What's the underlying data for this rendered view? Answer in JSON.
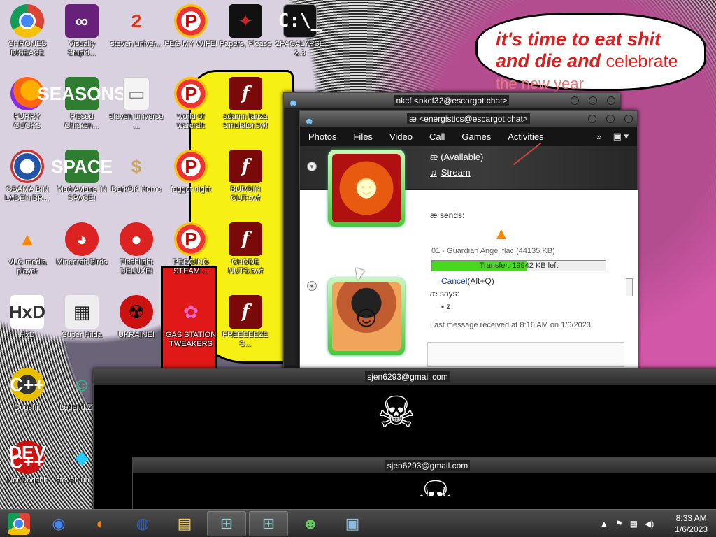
{
  "wallpaper": {
    "speech_line1": "it's time to eat shit",
    "speech_line2a": "and die and",
    "speech_line2b": "celebrate",
    "speech_line3": "the new year"
  },
  "desktop_icons": [
    {
      "label": "CHRONES DISEASE",
      "icon": "chrome-icon",
      "glyph": ""
    },
    {
      "label": "Visually Stupid...",
      "icon": "visual-studio-icon",
      "glyph": "∞"
    },
    {
      "label": "steven univer...",
      "icon": "number-two-icon",
      "glyph": "2"
    },
    {
      "label": "PEG MY WIFE!",
      "icon": "peggle-icon",
      "glyph": "P"
    },
    {
      "label": "Papers, Please",
      "icon": "papers-please-icon",
      "glyph": "✦"
    },
    {
      "label": "2PACALYPSE 2.3",
      "icon": "command-prompt-icon",
      "glyph": "C:\\_"
    },
    {
      "label": "FURRY CUCKS",
      "icon": "firefox-icon",
      "glyph": ""
    },
    {
      "label": "Pissed Chicken...",
      "icon": "angry-birds-seasons-icon",
      "glyph": "SEASONS"
    },
    {
      "label": "steven universe ...",
      "icon": "document-icon",
      "glyph": "▭"
    },
    {
      "label": "world of warcraft",
      "icon": "peggle-icon",
      "glyph": "P"
    },
    {
      "label": "adamn lanza simulator.swf",
      "icon": "flash-icon",
      "glyph": "f"
    },
    {
      "label": "OSAMA BIN LADEN BR...",
      "icon": "obama-logo-icon",
      "glyph": ""
    },
    {
      "label": "Mad Avians IN SPACE!",
      "icon": "angry-birds-space-icon",
      "glyph": "SPACE"
    },
    {
      "label": "DarkOK Home",
      "icon": "money-bag-icon",
      "glyph": "$"
    },
    {
      "label": "faggot night",
      "icon": "peggle-icon",
      "glyph": "P"
    },
    {
      "label": "BURGIN OUT.swf",
      "icon": "flash-icon",
      "glyph": "f"
    },
    {
      "label": "VLC media player",
      "icon": "vlc-cone-icon",
      "glyph": "▲"
    },
    {
      "label": "Minecraft Birds",
      "icon": "angry-bird-icon",
      "glyph": "◕"
    },
    {
      "label": "Fleshlight DELUXE!",
      "icon": "red-bird-icon",
      "glyph": "●"
    },
    {
      "label": "PEGGING STEAM ...",
      "icon": "peggle-icon",
      "glyph": "P"
    },
    {
      "label": "CHODE NUTS.swf",
      "icon": "flash-icon",
      "glyph": "f"
    },
    {
      "label": "HxD",
      "icon": "hxd-icon",
      "glyph": "HxD"
    },
    {
      "label": "Super Hilda",
      "icon": "pixel-art-icon",
      "glyph": "▦"
    },
    {
      "label": "UKRAINE!",
      "icon": "radiation-icon",
      "glyph": "☢"
    },
    {
      "label": "GAS STATION TWEAKERS",
      "icon": "plant-icon",
      "glyph": "✿"
    },
    {
      "label": "FREEEEEZE S...",
      "icon": "flash-icon",
      "glyph": "f"
    },
    {
      "label": "Dogshit",
      "icon": "cpp-icon",
      "glyph": "C++"
    },
    {
      "label": "Legend Zilda",
      "icon": "link-character-icon",
      "glyph": "☺"
    },
    {
      "label": "Not Dogshit",
      "icon": "dev-cpp-icon",
      "glyph": "DEV C++"
    },
    {
      "label": "steven univer...",
      "icon": "diamond-icon",
      "glyph": "◆"
    }
  ],
  "window_nkcf": {
    "title": "nkcf <nkcf32@escargot.chat>"
  },
  "window_energ": {
    "title": "æ <energistics@escargot.chat>",
    "menu": [
      "Photos",
      "Files",
      "Video",
      "Call",
      "Games",
      "Activities"
    ],
    "more": "»",
    "toolbar_icon": "▣ ▾",
    "status_name": "æ",
    "status_text": "(Available)",
    "stream_note": "♫",
    "stream_label": "Stream",
    "sends": "æ sends:",
    "file_name": "01 - Guardian Angel.flac (44135 KB)",
    "transfer_text": "Transfer: 19942 KB left",
    "transfer_progress": 0.55,
    "cancel_link": "Cancel",
    "cancel_shortcut": "(Alt+Q)",
    "says": "æ says:",
    "message": "z",
    "last_message": "Last message received at 8:16 AM on 1/6/2023."
  },
  "terminal1": {
    "title": "sjen6293@gmail.com"
  },
  "terminal2": {
    "title": "sjen6293@gmail.com"
  },
  "taskbar": {
    "items": [
      {
        "icon": "chrome-icon",
        "glyph": "◉"
      },
      {
        "icon": "firefox-icon",
        "glyph": "◐"
      },
      {
        "icon": "obama-logo-icon",
        "glyph": "◍"
      },
      {
        "icon": "file-explorer-icon",
        "glyph": "▤"
      },
      {
        "icon": "network-computer-icon",
        "glyph": "⊞"
      },
      {
        "icon": "network-computer-icon",
        "glyph": "⊞"
      },
      {
        "icon": "messenger-icon",
        "glyph": "☻"
      },
      {
        "icon": "picture-icon",
        "glyph": "▣"
      }
    ],
    "time": "8:33 AM",
    "date": "1/6/2023"
  }
}
